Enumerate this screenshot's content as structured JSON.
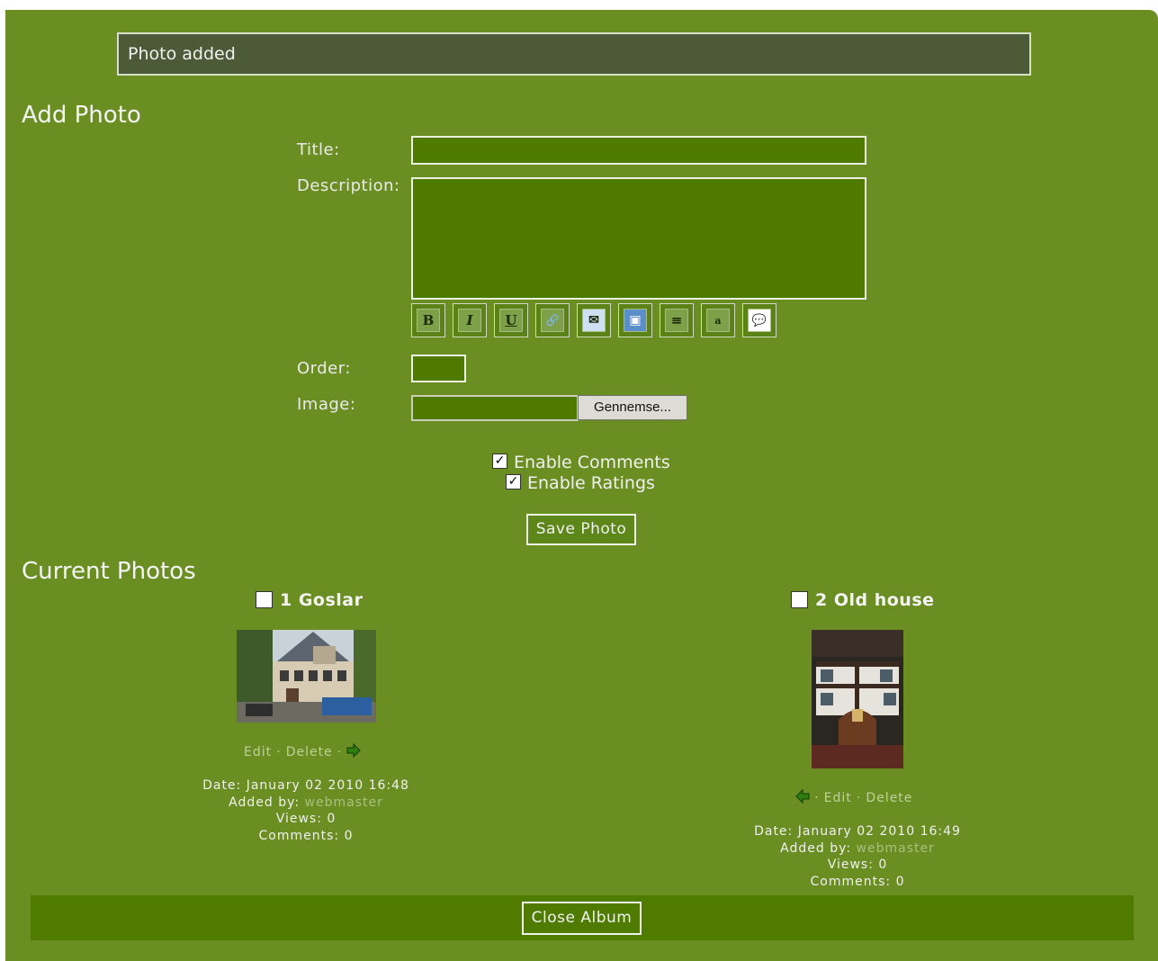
{
  "message": "Photo added",
  "add_photo": {
    "heading": "Add Photo",
    "title_label": "Title:",
    "title_value": "",
    "description_label": "Description:",
    "description_value": "",
    "toolbar": [
      {
        "icon": "bold-icon",
        "glyph": "B"
      },
      {
        "icon": "italic-icon",
        "glyph": "I"
      },
      {
        "icon": "underline-icon",
        "glyph": "U"
      },
      {
        "icon": "link-icon",
        "glyph": "🔗"
      },
      {
        "icon": "email-icon",
        "glyph": "✉"
      },
      {
        "icon": "image-icon",
        "glyph": "▣"
      },
      {
        "icon": "align-icon",
        "glyph": "≡"
      },
      {
        "icon": "font-size-icon",
        "glyph": "a"
      },
      {
        "icon": "quote-icon",
        "glyph": "💬"
      }
    ],
    "order_label": "Order:",
    "order_value": "",
    "image_label": "Image:",
    "browse_label": "Gennemse...",
    "enable_comments_label": "Enable Comments",
    "enable_comments_checked": true,
    "enable_ratings_label": "Enable Ratings",
    "enable_ratings_checked": true,
    "save_label": "Save Photo"
  },
  "current_photos": {
    "heading": "Current Photos",
    "photos": [
      {
        "title": "1 Goslar",
        "edit": "Edit",
        "delete": "Delete",
        "sep": "·",
        "date": "Date: January 02 2010 16:48",
        "added_by_label": "Added by:",
        "added_by": "webmaster",
        "views": "Views: 0",
        "comments": "Comments: 0"
      },
      {
        "title": "2 Old house",
        "edit": "Edit",
        "delete": "Delete",
        "sep": "·",
        "date": "Date: January 02 2010 16:49",
        "added_by_label": "Added by:",
        "added_by": "webmaster",
        "views": "Views: 0",
        "comments": "Comments: 0"
      }
    ]
  },
  "close_label": "Close Album",
  "colors": {
    "panel": "#6b8e23",
    "field": "#4f7a00",
    "message_bg": "#4c5a37",
    "footer": "#4f7c00"
  }
}
